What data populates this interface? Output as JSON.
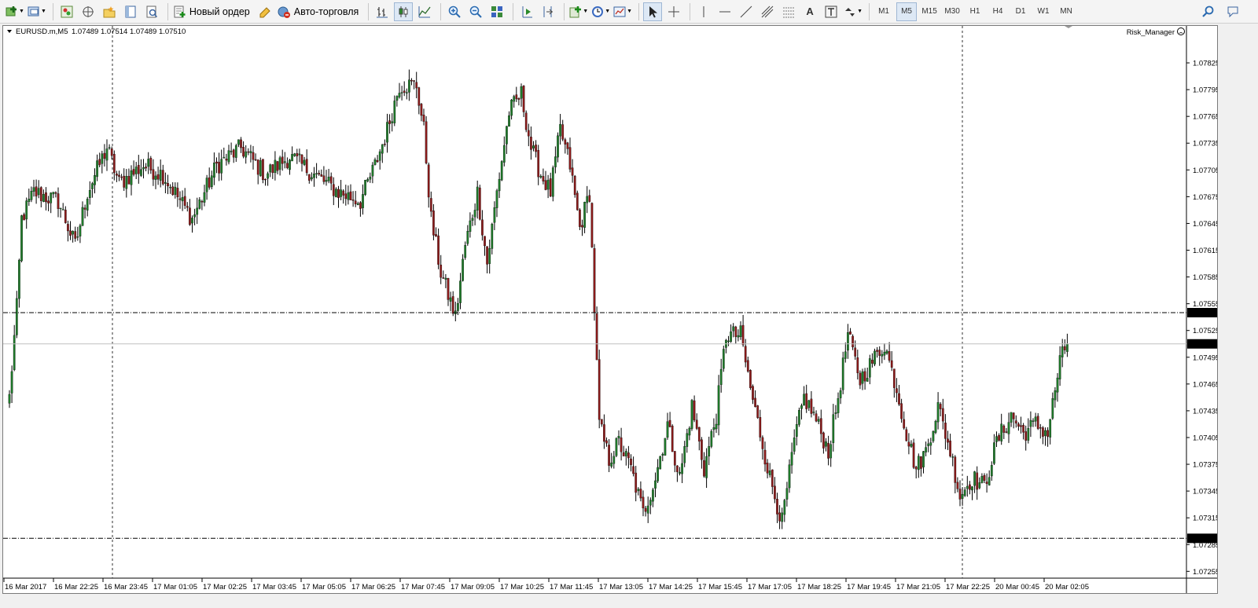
{
  "toolbar": {
    "new_order_label": "Новый ордер",
    "auto_trading_label": "Авто-торговля",
    "timeframes": [
      "M1",
      "M5",
      "M15",
      "M30",
      "H1",
      "H4",
      "D1",
      "W1",
      "MN"
    ],
    "active_timeframe": "M5",
    "text_tool_label": "A"
  },
  "header": {
    "symbol": "EURUSD.m,M5",
    "ohlc": "1.07489 1.07514 1.07489 1.07510",
    "indicator_name": "Risk_Manager"
  },
  "colors": {
    "bull": "#1f7a2a",
    "bear": "#8b1a1a",
    "wick": "#000000",
    "grid_dash": "#000000",
    "bid_line": "#c0c0c0"
  },
  "chart_data": {
    "type": "candlestick",
    "symbol": "EURUSD.m",
    "timeframe": "M5",
    "y_ticks": [
      "1.07825",
      "1.07795",
      "1.07765",
      "1.07735",
      "1.07705",
      "1.07675",
      "1.07645",
      "1.07615",
      "1.07585",
      "1.07555",
      "1.07525",
      "1.07495",
      "1.07465",
      "1.07435",
      "1.07405",
      "1.07375",
      "1.07345",
      "1.07315",
      "1.07285",
      "1.07255"
    ],
    "ylim": [
      1.0725,
      1.0784
    ],
    "x_ticks": [
      "16 Mar 2017",
      "16 Mar 22:25",
      "16 Mar 23:45",
      "17 Mar 01:05",
      "17 Mar 02:25",
      "17 Mar 03:45",
      "17 Mar 05:05",
      "17 Mar 06:25",
      "17 Mar 07:45",
      "17 Mar 09:05",
      "17 Mar 10:25",
      "17 Mar 11:45",
      "17 Mar 13:05",
      "17 Mar 14:25",
      "17 Mar 15:45",
      "17 Mar 17:05",
      "17 Mar 18:25",
      "17 Mar 19:45",
      "17 Mar 21:05",
      "17 Mar 22:25",
      "20 Mar 00:45",
      "20 Mar 02:05"
    ],
    "price_lines": [
      {
        "label": "1.07545",
        "value": 1.07545,
        "style": "dashdot"
      },
      {
        "label": "1.07510",
        "value": 1.0751,
        "style": "bid"
      },
      {
        "label": "1.07292",
        "value": 1.07292,
        "style": "dashdot"
      }
    ],
    "anchor_closes": [
      [
        0,
        1.0745
      ],
      [
        3,
        1.0755
      ],
      [
        5,
        1.0765
      ],
      [
        10,
        1.0768
      ],
      [
        20,
        1.0767
      ],
      [
        27,
        1.0762
      ],
      [
        32,
        1.0768
      ],
      [
        40,
        1.0773
      ],
      [
        45,
        1.0769
      ],
      [
        55,
        1.0771
      ],
      [
        63,
        1.077
      ],
      [
        75,
        1.0765
      ],
      [
        85,
        1.0771
      ],
      [
        95,
        1.0773
      ],
      [
        105,
        1.077
      ],
      [
        115,
        1.0772
      ],
      [
        125,
        1.077
      ],
      [
        135,
        1.0768
      ],
      [
        144,
        1.0767
      ],
      [
        150,
        1.0771
      ],
      [
        155,
        1.0775
      ],
      [
        160,
        1.078
      ],
      [
        167,
        1.078
      ],
      [
        170,
        1.0775
      ],
      [
        173,
        1.0765
      ],
      [
        177,
        1.0759
      ],
      [
        183,
        1.0754
      ],
      [
        187,
        1.0762
      ],
      [
        192,
        1.0768
      ],
      [
        196,
        1.076
      ],
      [
        200,
        1.0768
      ],
      [
        205,
        1.0777
      ],
      [
        210,
        1.0779
      ],
      [
        214,
        1.0773
      ],
      [
        218,
        1.077
      ],
      [
        222,
        1.0768
      ],
      [
        226,
        1.0775
      ],
      [
        230,
        1.0771
      ],
      [
        234,
        1.0764
      ],
      [
        238,
        1.0768
      ],
      [
        242,
        1.0742
      ],
      [
        246,
        1.0738
      ],
      [
        250,
        1.074
      ],
      [
        255,
        1.0737
      ],
      [
        260,
        1.0732
      ],
      [
        265,
        1.0736
      ],
      [
        270,
        1.0742
      ],
      [
        275,
        1.0736
      ],
      [
        280,
        1.0744
      ],
      [
        285,
        1.0737
      ],
      [
        290,
        1.0743
      ],
      [
        294,
        1.0752
      ],
      [
        300,
        1.0752
      ],
      [
        304,
        1.0746
      ],
      [
        308,
        1.0741
      ],
      [
        312,
        1.0736
      ],
      [
        317,
        1.0731
      ],
      [
        322,
        1.074
      ],
      [
        326,
        1.0745
      ],
      [
        330,
        1.0743
      ],
      [
        336,
        1.0739
      ],
      [
        340,
        1.0745
      ],
      [
        344,
        1.0752
      ],
      [
        349,
        1.0747
      ],
      [
        354,
        1.0749
      ],
      [
        359,
        1.0751
      ],
      [
        364,
        1.0746
      ],
      [
        368,
        1.0741
      ],
      [
        372,
        1.0737
      ],
      [
        376,
        1.0739
      ],
      [
        381,
        1.0744
      ],
      [
        386,
        1.0739
      ],
      [
        390,
        1.0734
      ],
      [
        395,
        1.0736
      ],
      [
        400,
        1.0735
      ],
      [
        405,
        1.074
      ],
      [
        411,
        1.0743
      ],
      [
        416,
        1.0741
      ],
      [
        421,
        1.0742
      ],
      [
        426,
        1.0741
      ],
      [
        431,
        1.0749
      ],
      [
        434,
        1.0751
      ]
    ]
  }
}
